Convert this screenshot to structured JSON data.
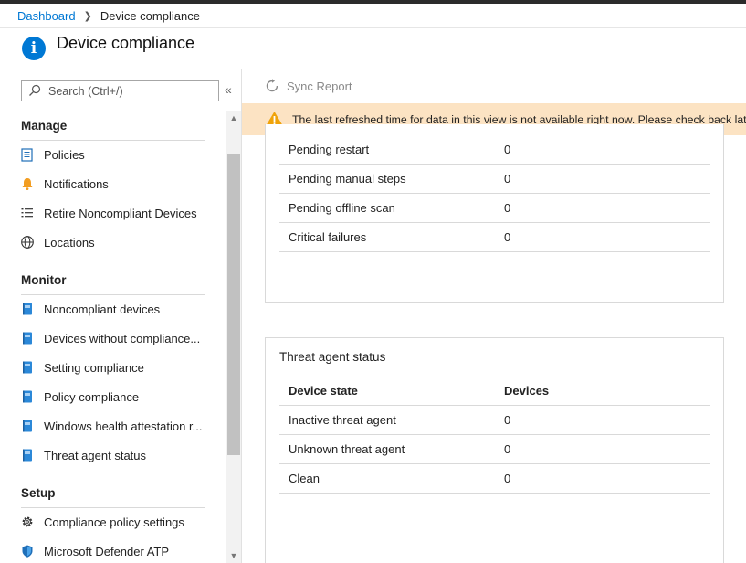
{
  "breadcrumb": {
    "root": "Dashboard",
    "current": "Device compliance"
  },
  "page": {
    "title": "Device compliance"
  },
  "search": {
    "placeholder": "Search (Ctrl+/)"
  },
  "nav": {
    "manage_title": "Manage",
    "manage_items": [
      {
        "label": "Policies",
        "icon": "policies-icon"
      },
      {
        "label": "Notifications",
        "icon": "bell-icon"
      },
      {
        "label": "Retire Noncompliant Devices",
        "icon": "list-icon"
      },
      {
        "label": "Locations",
        "icon": "globe-icon"
      }
    ],
    "monitor_title": "Monitor",
    "monitor_items": [
      {
        "label": "Noncompliant devices",
        "icon": "report-icon"
      },
      {
        "label": "Devices without compliance...",
        "icon": "report-icon"
      },
      {
        "label": "Setting compliance",
        "icon": "report-icon"
      },
      {
        "label": "Policy compliance",
        "icon": "report-icon"
      },
      {
        "label": "Windows health attestation r...",
        "icon": "report-icon"
      },
      {
        "label": "Threat agent status",
        "icon": "report-icon"
      }
    ],
    "setup_title": "Setup",
    "setup_items": [
      {
        "label": "Compliance policy settings",
        "icon": "gear-icon"
      },
      {
        "label": "Microsoft Defender ATP",
        "icon": "shield-icon"
      }
    ]
  },
  "toolbar": {
    "sync_label": "Sync Report"
  },
  "warning": {
    "text": "The last refreshed time for data in this view is not available right now. Please check back later.",
    "color": "#fce3c3"
  },
  "status_table": {
    "rows": [
      {
        "state": "Pending restart",
        "count": "0"
      },
      {
        "state": "Pending manual steps",
        "count": "0"
      },
      {
        "state": "Pending offline scan",
        "count": "0"
      },
      {
        "state": "Critical failures",
        "count": "0"
      }
    ]
  },
  "threat_card": {
    "title": "Threat agent status",
    "headers": {
      "state": "Device state",
      "devices": "Devices"
    },
    "rows": [
      {
        "state": "Inactive threat agent",
        "count": "0"
      },
      {
        "state": "Unknown threat agent",
        "count": "0"
      },
      {
        "state": "Clean",
        "count": "0"
      }
    ]
  },
  "colors": {
    "accent": "#0078d4",
    "warning_icon": "#f0a30a"
  }
}
